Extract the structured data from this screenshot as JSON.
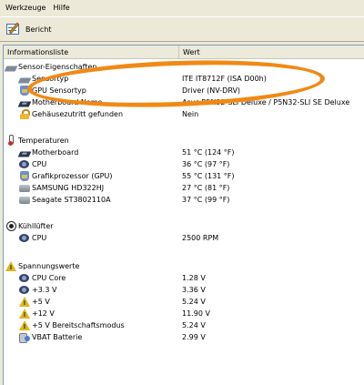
{
  "menubar": {
    "items": [
      "Werkzeuge",
      "Hilfe"
    ]
  },
  "toolbar": {
    "report_label": "Bericht"
  },
  "columns": {
    "name": "Informationsliste",
    "value": "Wert"
  },
  "sections": {
    "sensor": {
      "title": "Sensor-Eigenschaften",
      "rows": [
        {
          "label": "Sensortyp",
          "value": "ITE IT8712F  (ISA D00h)",
          "icon": "sensor-chip-icon"
        },
        {
          "label": "GPU Sensortyp",
          "value": "Driver  (NV-DRV)",
          "icon": "gpu-icon"
        },
        {
          "label": "Motherboard Name",
          "value": "Asus P5N32-SLI Deluxe / P5N32-SLI SE Deluxe",
          "icon": "motherboard-icon"
        },
        {
          "label": "Gehäusezutritt gefunden",
          "value": "Nein",
          "icon": "lock-icon"
        }
      ]
    },
    "temperatures": {
      "title": "Temperaturen",
      "rows": [
        {
          "label": "Motherboard",
          "value": "51 °C  (124 °F)"
        },
        {
          "label": "CPU",
          "value": "36 °C  (97 °F)"
        },
        {
          "label": "Grafikprozessor (GPU)",
          "value": "55 °C  (131 °F)"
        },
        {
          "label": "SAMSUNG HD322HJ",
          "value": "27 °C  (81 °F)"
        },
        {
          "label": "Seagate ST3802110A",
          "value": "37 °C  (99 °F)"
        }
      ]
    },
    "fans": {
      "title": "Kühllüfter",
      "rows": [
        {
          "label": "CPU",
          "value": "2500 RPM"
        }
      ]
    },
    "voltages": {
      "title": "Spannungswerte",
      "rows": [
        {
          "label": "CPU Core",
          "value": "1.28 V"
        },
        {
          "label": "+3.3 V",
          "value": "3.36 V"
        },
        {
          "label": "+5 V",
          "value": "5.24 V"
        },
        {
          "label": "+12 V",
          "value": "11.90 V"
        },
        {
          "label": "+5 V Bereitschaftsmodus",
          "value": "5.24 V"
        },
        {
          "label": "VBAT Batterie",
          "value": "2.99 V"
        }
      ]
    }
  },
  "annotation": {
    "ring_color": "#f08a14"
  }
}
